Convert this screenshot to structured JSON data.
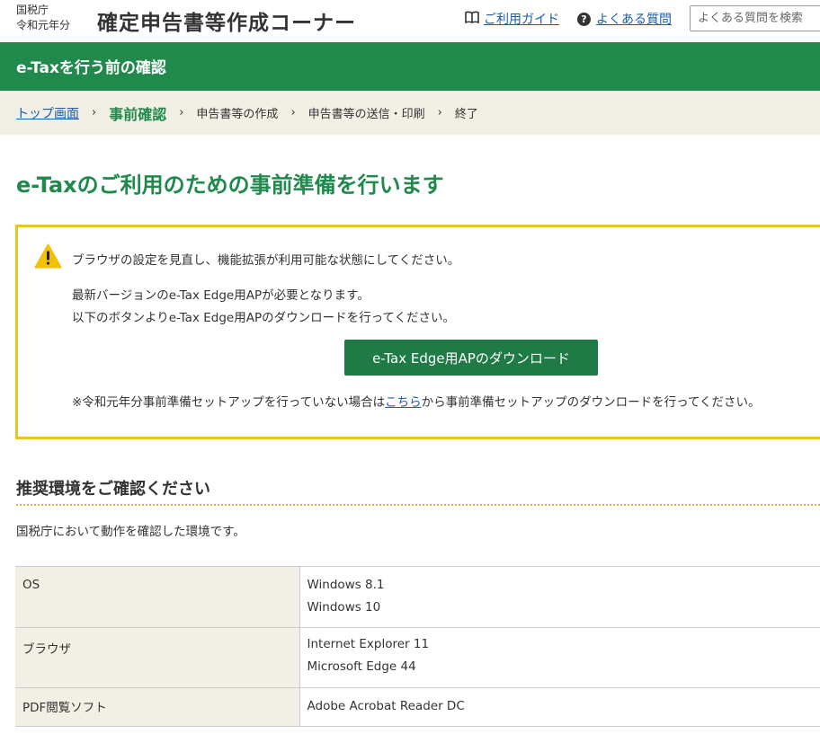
{
  "header": {
    "agency": "国税庁",
    "year": "令和元年分",
    "title": "確定申告書等作成コーナー",
    "guide_link": "ご利用ガイド",
    "faq_link": "よくある質問",
    "search_placeholder": "よくある質問を検索"
  },
  "banner": {
    "title": "e-Taxを行う前の確認"
  },
  "breadcrumb": {
    "items": [
      "トップ画面",
      "事前確認",
      "申告書等の作成",
      "申告書等の送信・印刷",
      "終了"
    ],
    "separator": "›"
  },
  "main": {
    "heading": "e-Taxのご利用のための事前準備を行います"
  },
  "notice": {
    "line1": "ブラウザの設定を見直し、機能拡張が利用可能な状態にしてください。",
    "line2": "最新バージョンのe-Tax Edge用APが必要となります。",
    "line3": "以下のボタンよりe-Tax Edge用APのダウンロードを行ってください。",
    "download_button": "e-Tax Edge用APのダウンロード",
    "footnote_before": "※令和元年分事前準備セットアップを行っていない場合は",
    "footnote_link": "こちら",
    "footnote_after": "から事前準備セットアップのダウンロードを行ってください。"
  },
  "environment": {
    "heading": "推奨環境をご確認ください",
    "description": "国税庁において動作を確認した環境です。",
    "rows": [
      {
        "label": "OS",
        "values": [
          "Windows 8.1",
          "Windows 10"
        ]
      },
      {
        "label": "ブラウザ",
        "values": [
          "Internet Explorer 11",
          "Microsoft Edge 44"
        ]
      },
      {
        "label": "PDF閲覧ソフト",
        "values": [
          "Adobe Acrobat Reader DC"
        ]
      }
    ]
  },
  "colors": {
    "brand_green": "#1f8a4c",
    "button_green": "#1f7a45",
    "notice_border": "#e8c524",
    "breadcrumb_bg": "#f2efe4",
    "link_blue": "#1a5dab"
  },
  "icons": {
    "guide": "book-icon",
    "faq": "question-circle-icon",
    "warning": "warning-triangle-icon"
  }
}
